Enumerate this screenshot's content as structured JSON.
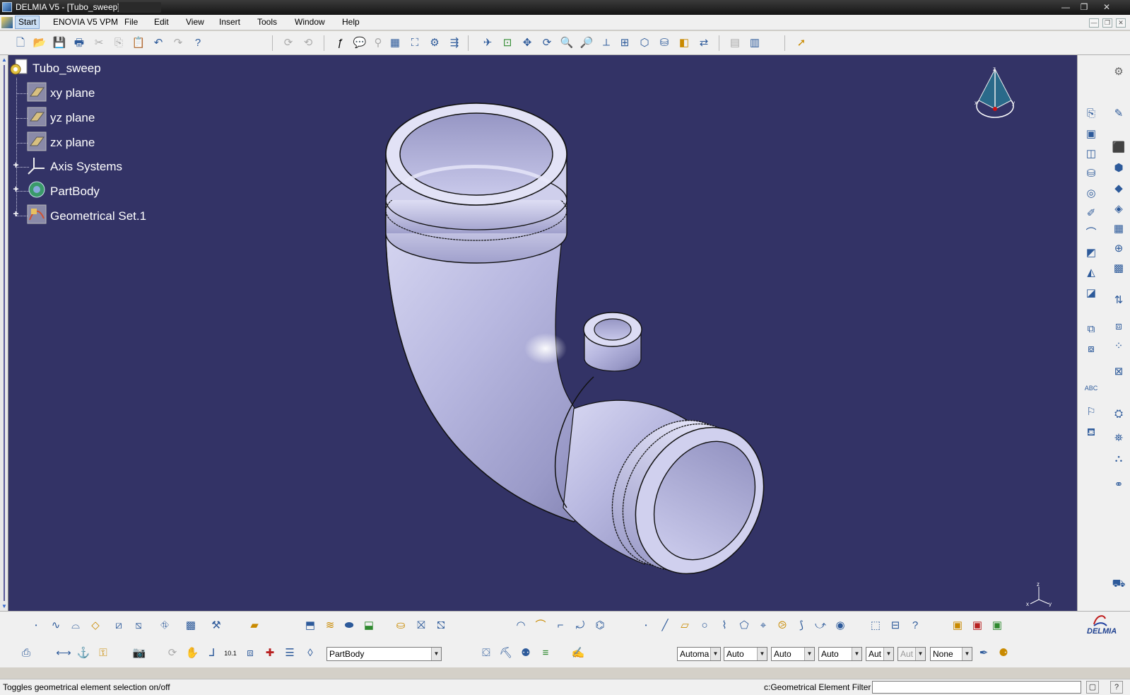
{
  "window": {
    "title": "DELMIA V5 - [Tubo_sweep]",
    "controls": [
      "—",
      "❐",
      "✕"
    ]
  },
  "menubar": {
    "items": [
      "Start",
      "ENOVIA V5 VPM",
      "File",
      "Edit",
      "View",
      "Insert",
      "Tools",
      "Window",
      "Help"
    ],
    "mdi_controls": [
      "—",
      "❐",
      "✕"
    ]
  },
  "tree": {
    "root": "Tubo_sweep",
    "nodes": [
      {
        "label": "xy plane"
      },
      {
        "label": "yz plane"
      },
      {
        "label": "zx plane"
      },
      {
        "label": "Axis Systems"
      },
      {
        "label": "PartBody"
      },
      {
        "label": "Geometrical Set.1"
      }
    ]
  },
  "bottom": {
    "body_select": "PartBody",
    "combos": [
      "Automa",
      "Auto",
      "Auto",
      "Auto",
      "Aut",
      "Aut",
      "None"
    ]
  },
  "status": {
    "message": "Toggles geometrical element selection on/off",
    "filter_label": "c:Geometrical Element Filter"
  },
  "brand": {
    "logo_text": "DELMIA"
  },
  "compass": {
    "axis_z": "z",
    "axis_x": "x",
    "axis_y": "y"
  },
  "colors": {
    "viewport": "#333366",
    "part": "#c8c8e8"
  }
}
